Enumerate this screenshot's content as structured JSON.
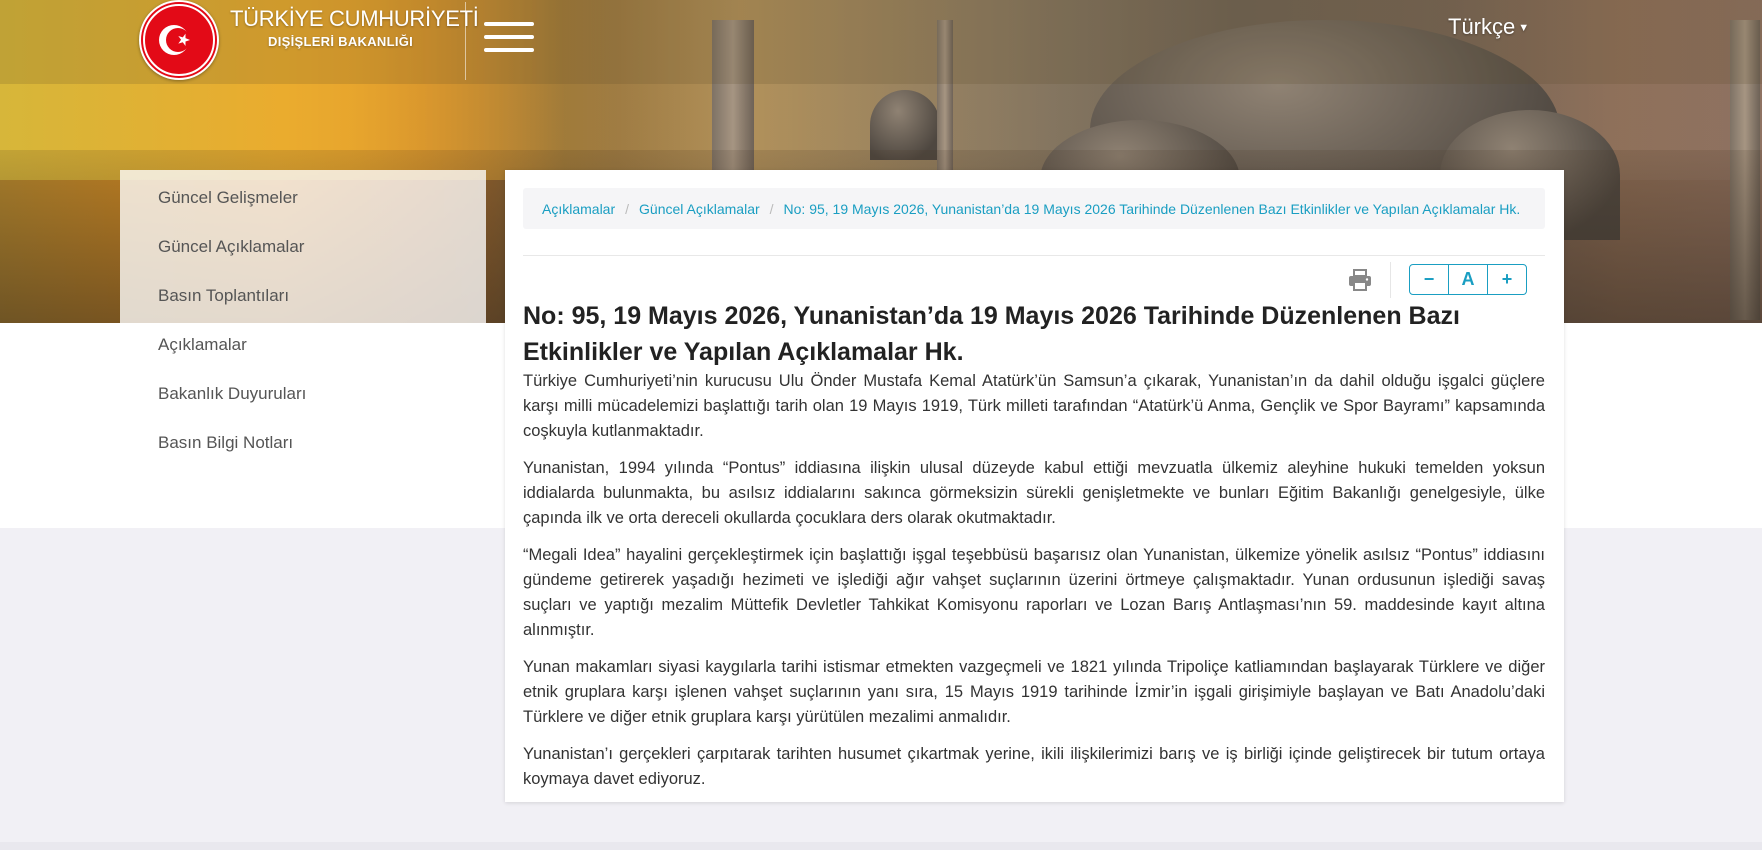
{
  "header": {
    "brand_title": "TÜRKİYE CUMHURİYETİ",
    "brand_subtitle": "DIŞİŞLERİ BAKANLIĞI",
    "language": "Türkçe"
  },
  "sidebar": {
    "items": [
      {
        "label": "Güncel Gelişmeler"
      },
      {
        "label": "Güncel Açıklamalar"
      },
      {
        "label": "Basın Toplantıları"
      },
      {
        "label": "Açıklamalar"
      },
      {
        "label": "Bakanlık Duyuruları"
      },
      {
        "label": "Basın Bilgi Notları"
      }
    ]
  },
  "breadcrumb": [
    {
      "label": "Açıklamalar"
    },
    {
      "label": "Güncel Açıklamalar"
    },
    {
      "label": "No: 95, 19 Mayıs 2026, Yunanistan’da 19 Mayıs 2026 Tarihinde Düzenlenen Bazı Etkinlikler ve Yapılan Açıklamalar Hk."
    }
  ],
  "toolbar": {
    "decrease_label": "−",
    "reset_label": "A",
    "increase_label": "+"
  },
  "article": {
    "title": "No: 95, 19 Mayıs 2026, Yunanistan’da 19 Mayıs 2026 Tarihinde Düzenlenen Bazı Etkinlikler ve Yapılan Açıklamalar Hk.",
    "paragraphs": [
      "Türkiye Cumhuriyeti’nin kurucusu Ulu Önder Mustafa Kemal Atatürk’ün Samsun’a çıkarak, Yunanistan’ın da dahil olduğu işgalci güçlere karşı milli mücadelemizi başlattığı tarih olan 19 Mayıs 1919, Türk milleti tarafından “Atatürk’ü Anma, Gençlik ve Spor Bayramı” kapsamında coşkuyla kutlanmaktadır.",
      "Yunanistan, 1994 yılında “Pontus” iddiasına ilişkin ulusal düzeyde kabul ettiği mevzuatla ülkemiz aleyhine hukuki temelden yoksun iddialarda bulunmakta, bu asılsız iddialarını sakınca görmeksizin sürekli genişletmekte ve bunları Eğitim Bakanlığı genelgesiyle, ülke çapında ilk ve orta dereceli okullarda çocuklara ders olarak okutmaktadır.",
      "“Megali Idea” hayalini gerçekleştirmek için başlattığı işgal teşebbüsü başarısız olan Yunanistan, ülkemize yönelik asılsız “Pontus” iddiasını gündeme getirerek yaşadığı hezimeti ve işlediği ağır vahşet suçlarının üzerini örtmeye çalışmaktadır. Yunan ordusunun işlediği savaş suçları ve yaptığı mezalim Müttefik Devletler Tahkikat Komisyonu raporları ve Lozan Barış Antlaşması’nın 59. maddesinde kayıt altına alınmıştır.",
      "Yunan makamları siyasi kaygılarla tarihi istismar etmekten vazgeçmeli ve 1821 yılında Tripoliçe katliamından başlayarak Türklere ve diğer etnik gruplara karşı işlenen vahşet suçlarının yanı sıra, 15 Mayıs 1919 tarihinde İzmir’in işgali girişimiyle başlayan ve Batı Anadolu’daki Türklere ve diğer etnik gruplara karşı yürütülen mezalimi anmalıdır.",
      "Yunanistan’ı gerçekleri çarpıtarak tarihten husumet çıkartmak yerine, ikili ilişkilerimizi barış ve iş birliği içinde geliştirecek bir tutum ortaya koymaya davet ediyoruz."
    ]
  },
  "colors": {
    "accent": "#1a9ec2",
    "flag_red": "#e30a17"
  }
}
